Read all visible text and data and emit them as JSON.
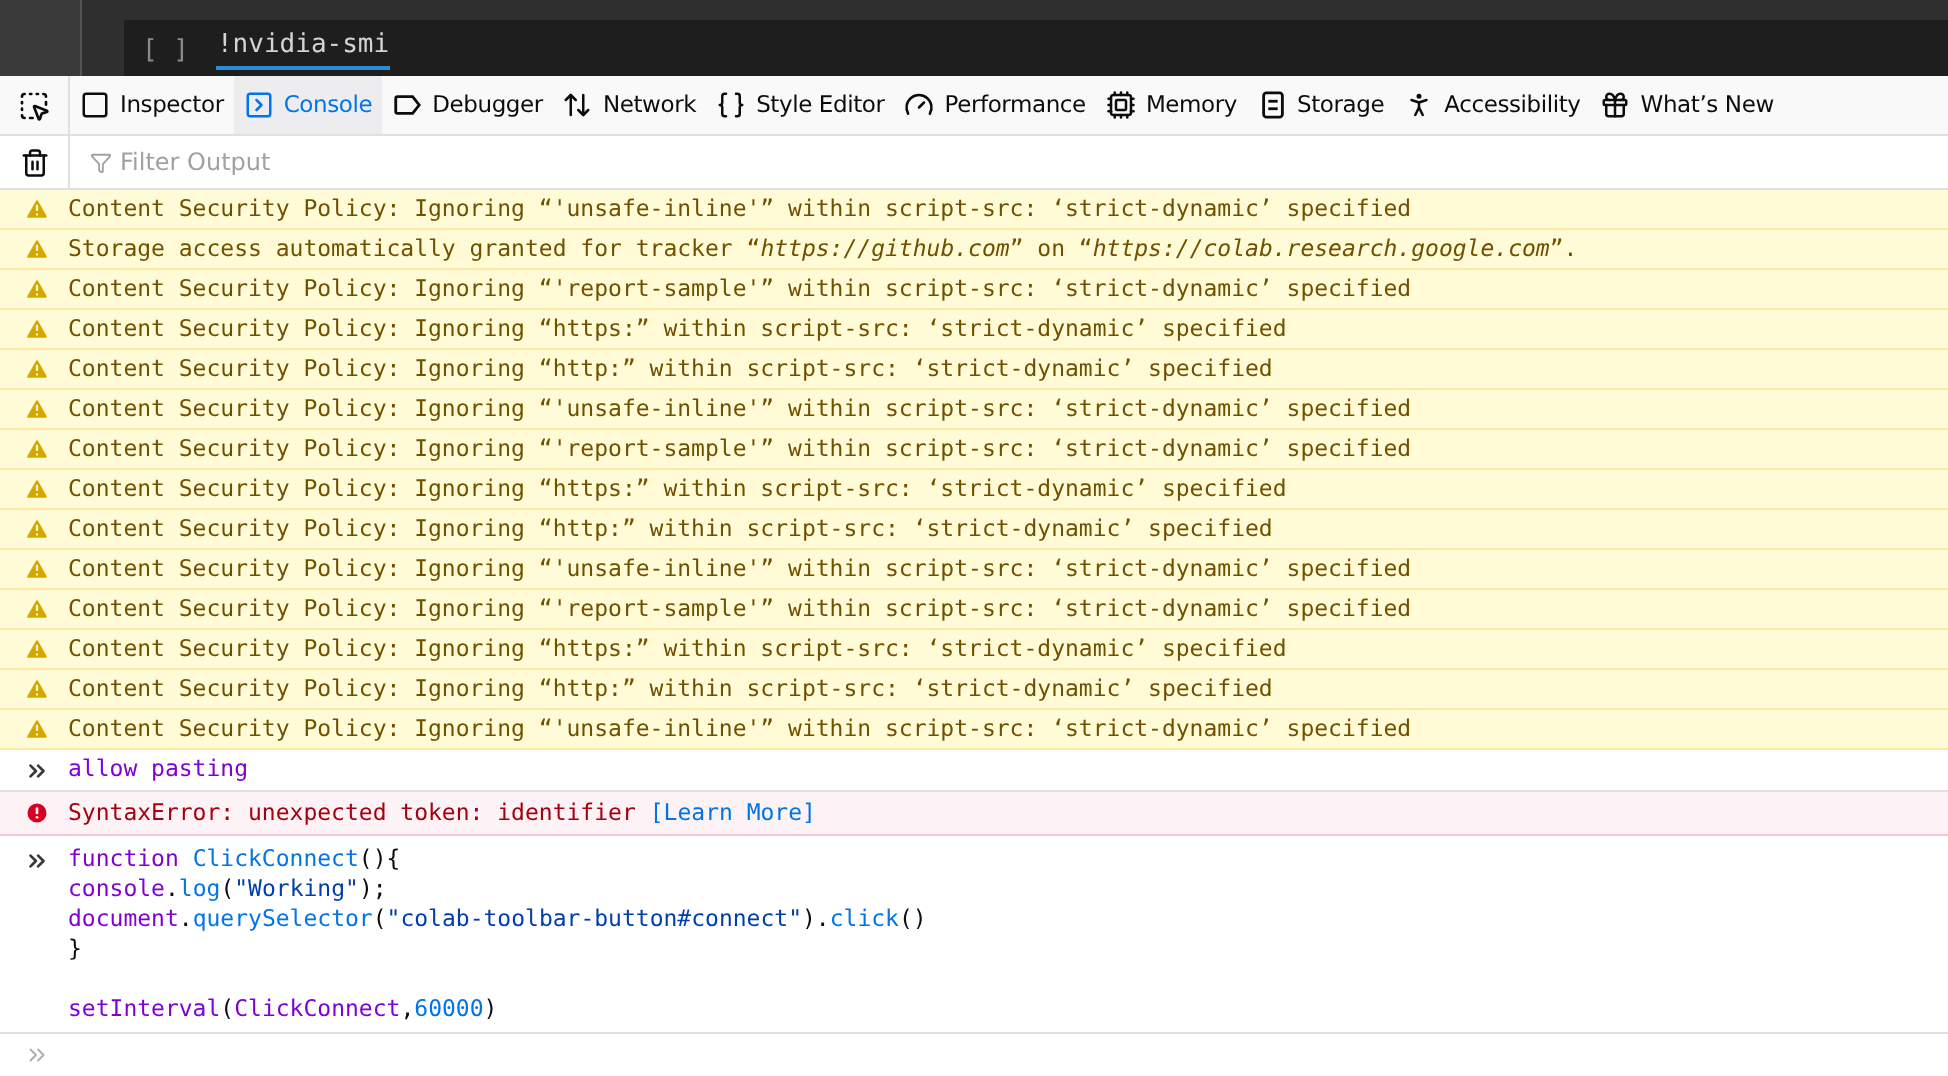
{
  "notebook_cell": {
    "bracket": "[ ]",
    "code": "!nvidia-smi"
  },
  "tabs": [
    {
      "label": "Inspector",
      "kind": "inspector",
      "selected": false
    },
    {
      "label": "Console",
      "kind": "console",
      "selected": true
    },
    {
      "label": "Debugger",
      "kind": "debugger",
      "selected": false
    },
    {
      "label": "Network",
      "kind": "network",
      "selected": false
    },
    {
      "label": "Style Editor",
      "kind": "style",
      "selected": false
    },
    {
      "label": "Performance",
      "kind": "performance",
      "selected": false
    },
    {
      "label": "Memory",
      "kind": "memory",
      "selected": false
    },
    {
      "label": "Storage",
      "kind": "storage",
      "selected": false
    },
    {
      "label": "Accessibility",
      "kind": "accessibility",
      "selected": false
    },
    {
      "label": "What’s New",
      "kind": "new",
      "selected": false
    }
  ],
  "filter": {
    "placeholder": "Filter Output"
  },
  "console": [
    {
      "kind": "warning",
      "text": "Content Security Policy: Ignoring “'unsafe-inline'” within script-src: ‘strict-dynamic’ specified"
    },
    {
      "kind": "warning",
      "text": "Storage access automatically granted for tracker “*https://github.com*” on “*https://colab.research.google.com*”."
    },
    {
      "kind": "warning",
      "text": "Content Security Policy: Ignoring “'report-sample'” within script-src: ‘strict-dynamic’ specified"
    },
    {
      "kind": "warning",
      "text": "Content Security Policy: Ignoring “https:” within script-src: ‘strict-dynamic’ specified"
    },
    {
      "kind": "warning",
      "text": "Content Security Policy: Ignoring “http:” within script-src: ‘strict-dynamic’ specified"
    },
    {
      "kind": "warning",
      "text": "Content Security Policy: Ignoring “'unsafe-inline'” within script-src: ‘strict-dynamic’ specified"
    },
    {
      "kind": "warning",
      "text": "Content Security Policy: Ignoring “'report-sample'” within script-src: ‘strict-dynamic’ specified"
    },
    {
      "kind": "warning",
      "text": "Content Security Policy: Ignoring “https:” within script-src: ‘strict-dynamic’ specified"
    },
    {
      "kind": "warning",
      "text": "Content Security Policy: Ignoring “http:” within script-src: ‘strict-dynamic’ specified"
    },
    {
      "kind": "warning",
      "text": "Content Security Policy: Ignoring “'unsafe-inline'” within script-src: ‘strict-dynamic’ specified"
    },
    {
      "kind": "warning",
      "text": "Content Security Policy: Ignoring “'report-sample'” within script-src: ‘strict-dynamic’ specified"
    },
    {
      "kind": "warning",
      "text": "Content Security Policy: Ignoring “https:” within script-src: ‘strict-dynamic’ specified"
    },
    {
      "kind": "warning",
      "text": "Content Security Policy: Ignoring “http:” within script-src: ‘strict-dynamic’ specified"
    },
    {
      "kind": "warning",
      "text": "Content Security Policy: Ignoring “'unsafe-inline'” within script-src: ‘strict-dynamic’ specified"
    },
    {
      "kind": "input",
      "text": "allow pasting"
    },
    {
      "kind": "error",
      "text": "SyntaxError: unexpected token: identifier",
      "link": "[Learn More]"
    },
    {
      "kind": "code",
      "lines": [
        {
          "spaced": false,
          "tokens": [
            {
              "text": "function ",
              "kind": "keyword"
            },
            {
              "text": "ClickConnect",
              "kind": "def"
            },
            {
              "text": "(){",
              "kind": "punct"
            }
          ]
        },
        {
          "spaced": false,
          "tokens": [
            {
              "text": "console",
              "kind": "variable"
            },
            {
              "text": ".",
              "kind": "punct"
            },
            {
              "text": "log",
              "kind": "def"
            },
            {
              "text": "(",
              "kind": "punct"
            },
            {
              "text": "\"Working\"",
              "kind": "string"
            },
            {
              "text": ");",
              "kind": "punct"
            }
          ]
        },
        {
          "spaced": false,
          "tokens": [
            {
              "text": "document",
              "kind": "variable"
            },
            {
              "text": ".",
              "kind": "punct"
            },
            {
              "text": "querySelector",
              "kind": "def"
            },
            {
              "text": "(",
              "kind": "punct"
            },
            {
              "text": "\"colab-toolbar-button#connect\"",
              "kind": "string"
            },
            {
              "text": ").",
              "kind": "punct"
            },
            {
              "text": "click",
              "kind": "def"
            },
            {
              "text": "()",
              "kind": "punct"
            }
          ]
        },
        {
          "spaced": false,
          "tokens": [
            {
              "text": "}",
              "kind": "punct"
            }
          ]
        },
        {
          "spaced": true,
          "tokens": [
            {
              "text": "setInterval",
              "kind": "variable"
            },
            {
              "text": "(",
              "kind": "punct"
            },
            {
              "text": "ClickConnect",
              "kind": "variable"
            },
            {
              "text": ",",
              "kind": "punct"
            },
            {
              "text": "60000",
              "kind": "number"
            },
            {
              "text": ")",
              "kind": "punct"
            }
          ]
        }
      ]
    }
  ]
}
